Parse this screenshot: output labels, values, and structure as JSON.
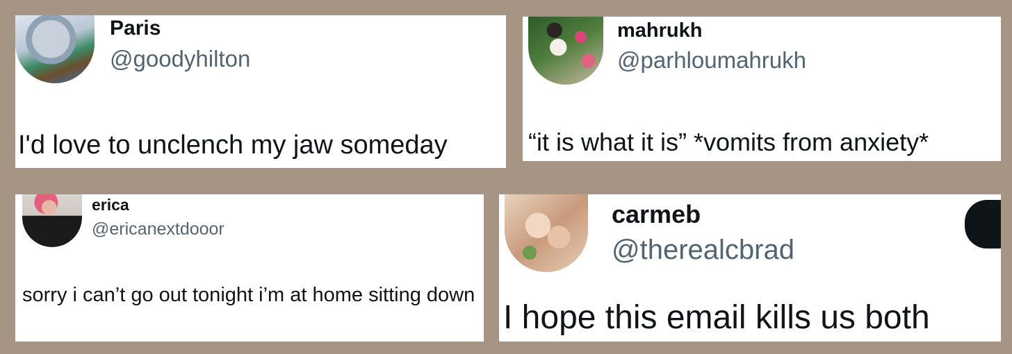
{
  "colors": {
    "background": "#a69585",
    "card": "#ffffff",
    "name": "#0f1419",
    "handle": "#536471"
  },
  "tweets": [
    {
      "name": "Paris",
      "handle": "@goodyhilton",
      "text": "I'd love to unclench my jaw someday",
      "avatar_icon": "avatar-image"
    },
    {
      "name": "mahrukh",
      "handle": "@parhloumahrukh",
      "text": "“it is what it is” *vomits from anxiety*",
      "avatar_icon": "avatar-image"
    },
    {
      "name": "erica",
      "handle": "@ericanextdooor",
      "text": "sorry i can’t go out tonight i’m at home sitting down",
      "avatar_icon": "avatar-image"
    },
    {
      "name": "carmeb",
      "handle": "@therealcbrad",
      "text": "I hope this email kills us both",
      "avatar_icon": "avatar-image"
    }
  ]
}
